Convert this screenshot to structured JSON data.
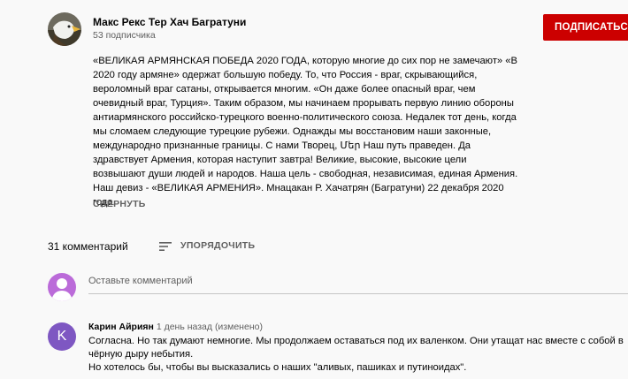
{
  "channel": {
    "name": "Макс Рекс Тер Хач Багратуни",
    "subscribers": "53 подписчика",
    "subscribe_label": "ПОДПИСАТЬСЯ"
  },
  "description": {
    "paragraphs": [
      "«ВЕЛИКАЯ АРМЯНСКАЯ ПОБЕДА 2020 ГОДА, которую многие до сих пор не замечают» «В 2020 году армяне» одержат большую победу. То, что Россия - враг, скрывающийся, вероломный враг сатаны, открывается многим. «Он даже более опасный враг, чем очевидный враг, Турция». Таким образом, мы начинаем прорывать первую линию обороны антиармянского российско-турецкого военно-политического союза. Недалек тот день, когда мы сломаем следующие турецкие рубежи. Однажды мы восстановим наши законные, международно признанные границы. С нами Творец, Մեր Наш путь праведен. Да здравствует Армения, которая наступит завтра! Великие, высокие, высокие цели возвышают души людей и народов. Наша цель - свободная, независимая, единая Армения. Наш девиз - «ВЕЛИКАЯ АРМЕНИЯ». Мнацакан Р. Хачатрян (Багратуни) 22 декабря 2020 года."
    ],
    "collapse_label": "СВЕРНУТЬ"
  },
  "comments_header": {
    "count": "31 комментарий",
    "sort_label": "УПОРЯДОЧИТЬ"
  },
  "new_comment": {
    "placeholder": "Оставьте комментарий"
  },
  "comments": [
    {
      "avatar_letter": "K",
      "author": "Карин Айриян",
      "time": "1 день назад (изменено)",
      "lines": [
        "Согласна. Но так думают немногие. Мы продолжаем оставаться под их валенком. Они утащат нас вместе с собой в чёрную дыру небытия.",
        "Но хотелось бы, чтобы вы высказались о наших \"аливых, пашиках и путиноидах\"."
      ]
    }
  ],
  "colors": {
    "subscribe": "#cc0000",
    "comment_avatar": "#7e57c2",
    "user_avatar": "#bb6bd9"
  }
}
